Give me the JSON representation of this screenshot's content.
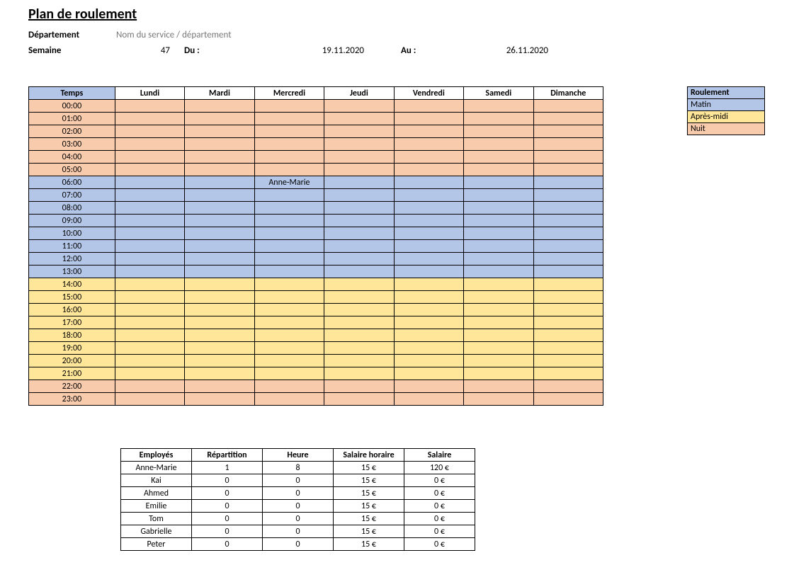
{
  "title": "Plan de roulement",
  "meta": {
    "dept_label": "Département",
    "dept_value": "Nom du service / département",
    "week_label": "Semaine",
    "week_value": "47",
    "from_label": "Du :",
    "from_value": "19.11.2020",
    "to_label": "Au :",
    "to_value": "26.11.2020"
  },
  "colors": {
    "matin": "#b4c6e7",
    "apresmidi": "#ffe699",
    "nuit": "#f8cbad"
  },
  "schedule": {
    "time_header": "Temps",
    "days": [
      "Lundi",
      "Mardi",
      "Mercredi",
      "Jeudi",
      "Vendredi",
      "Samedi",
      "Dimanche"
    ],
    "rows": [
      {
        "time": "00:00",
        "shift": "nuit",
        "cells": [
          "",
          "",
          "",
          "",
          "",
          "",
          ""
        ]
      },
      {
        "time": "01:00",
        "shift": "nuit",
        "cells": [
          "",
          "",
          "",
          "",
          "",
          "",
          ""
        ]
      },
      {
        "time": "02:00",
        "shift": "nuit",
        "cells": [
          "",
          "",
          "",
          "",
          "",
          "",
          ""
        ]
      },
      {
        "time": "03:00",
        "shift": "nuit",
        "cells": [
          "",
          "",
          "",
          "",
          "",
          "",
          ""
        ]
      },
      {
        "time": "04:00",
        "shift": "nuit",
        "cells": [
          "",
          "",
          "",
          "",
          "",
          "",
          ""
        ]
      },
      {
        "time": "05:00",
        "shift": "nuit",
        "cells": [
          "",
          "",
          "",
          "",
          "",
          "",
          ""
        ]
      },
      {
        "time": "06:00",
        "shift": "matin",
        "cells": [
          "",
          "",
          "Anne-Marie",
          "",
          "",
          "",
          ""
        ]
      },
      {
        "time": "07:00",
        "shift": "matin",
        "cells": [
          "",
          "",
          "",
          "",
          "",
          "",
          ""
        ]
      },
      {
        "time": "08:00",
        "shift": "matin",
        "cells": [
          "",
          "",
          "",
          "",
          "",
          "",
          ""
        ]
      },
      {
        "time": "09:00",
        "shift": "matin",
        "cells": [
          "",
          "",
          "",
          "",
          "",
          "",
          ""
        ]
      },
      {
        "time": "10:00",
        "shift": "matin",
        "cells": [
          "",
          "",
          "",
          "",
          "",
          "",
          ""
        ]
      },
      {
        "time": "11:00",
        "shift": "matin",
        "cells": [
          "",
          "",
          "",
          "",
          "",
          "",
          ""
        ]
      },
      {
        "time": "12:00",
        "shift": "matin",
        "cells": [
          "",
          "",
          "",
          "",
          "",
          "",
          ""
        ]
      },
      {
        "time": "13:00",
        "shift": "matin",
        "cells": [
          "",
          "",
          "",
          "",
          "",
          "",
          ""
        ]
      },
      {
        "time": "14:00",
        "shift": "apresmidi",
        "cells": [
          "",
          "",
          "",
          "",
          "",
          "",
          ""
        ]
      },
      {
        "time": "15:00",
        "shift": "apresmidi",
        "cells": [
          "",
          "",
          "",
          "",
          "",
          "",
          ""
        ]
      },
      {
        "time": "16:00",
        "shift": "apresmidi",
        "cells": [
          "",
          "",
          "",
          "",
          "",
          "",
          ""
        ]
      },
      {
        "time": "17:00",
        "shift": "apresmidi",
        "cells": [
          "",
          "",
          "",
          "",
          "",
          "",
          ""
        ]
      },
      {
        "time": "18:00",
        "shift": "apresmidi",
        "cells": [
          "",
          "",
          "",
          "",
          "",
          "",
          ""
        ]
      },
      {
        "time": "19:00",
        "shift": "apresmidi",
        "cells": [
          "",
          "",
          "",
          "",
          "",
          "",
          ""
        ]
      },
      {
        "time": "20:00",
        "shift": "apresmidi",
        "cells": [
          "",
          "",
          "",
          "",
          "",
          "",
          ""
        ]
      },
      {
        "time": "21:00",
        "shift": "apresmidi",
        "cells": [
          "",
          "",
          "",
          "",
          "",
          "",
          ""
        ]
      },
      {
        "time": "22:00",
        "shift": "nuit",
        "cells": [
          "",
          "",
          "",
          "",
          "",
          "",
          ""
        ]
      },
      {
        "time": "23:00",
        "shift": "nuit",
        "cells": [
          "",
          "",
          "",
          "",
          "",
          "",
          ""
        ]
      }
    ]
  },
  "legend": {
    "header": "Roulement",
    "items": [
      {
        "label": "Matin",
        "shift": "matin"
      },
      {
        "label": "Après-midi",
        "shift": "apresmidi"
      },
      {
        "label": "Nuit",
        "shift": "nuit"
      }
    ]
  },
  "employees": {
    "headers": [
      "Employés",
      "Répartition",
      "Heure",
      "Salaire horaire",
      "Salaire"
    ],
    "rows": [
      {
        "name": "Anne-Marie",
        "rep": "1",
        "hours": "8",
        "rate": "15 €",
        "salary": "120 €"
      },
      {
        "name": "Kai",
        "rep": "0",
        "hours": "0",
        "rate": "15 €",
        "salary": "0 €"
      },
      {
        "name": "Ahmed",
        "rep": "0",
        "hours": "0",
        "rate": "15 €",
        "salary": "0 €"
      },
      {
        "name": "Emilie",
        "rep": "0",
        "hours": "0",
        "rate": "15 €",
        "salary": "0 €"
      },
      {
        "name": "Tom",
        "rep": "0",
        "hours": "0",
        "rate": "15 €",
        "salary": "0 €"
      },
      {
        "name": "Gabrielle",
        "rep": "0",
        "hours": "0",
        "rate": "15 €",
        "salary": "0 €"
      },
      {
        "name": "Peter",
        "rep": "0",
        "hours": "0",
        "rate": "15 €",
        "salary": "0 €"
      }
    ]
  }
}
